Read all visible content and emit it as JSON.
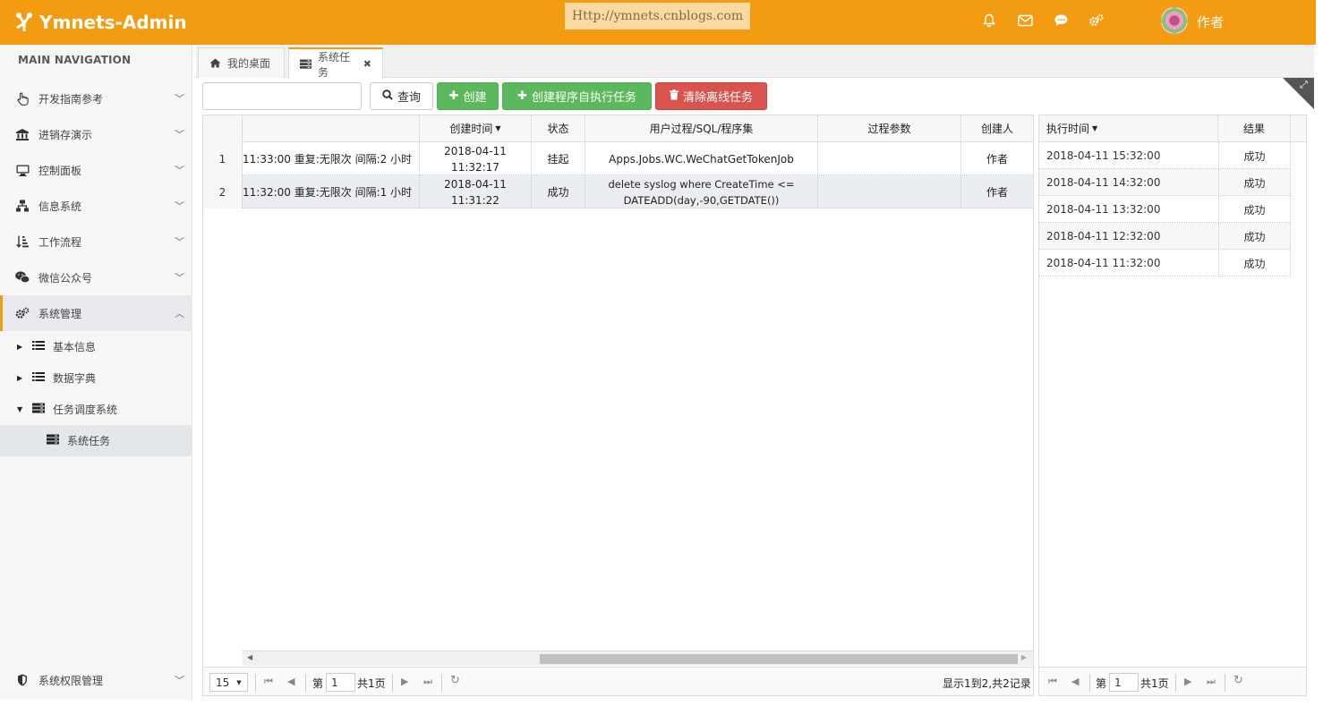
{
  "app": {
    "title": "Ymnets-Admin",
    "url_banner": "Http://ymnets.cnblogs.com",
    "user_name": "作者"
  },
  "colors": {
    "brand": "#f39c12",
    "success": "#5cb85c",
    "danger": "#d9534f"
  },
  "header_icons": [
    "bell-icon",
    "envelope-icon",
    "chat-icon",
    "gears-icon"
  ],
  "sidebar": {
    "heading": "MAIN NAVIGATION",
    "items": [
      {
        "label": "开发指南参考",
        "icon": "hand-pointer-icon"
      },
      {
        "label": "进销存演示",
        "icon": "bank-icon"
      },
      {
        "label": "控制面板",
        "icon": "desktop-icon"
      },
      {
        "label": "信息系统",
        "icon": "sitemap-icon"
      },
      {
        "label": "工作流程",
        "icon": "sort-amount-icon"
      },
      {
        "label": "微信公众号",
        "icon": "wechat-icon"
      },
      {
        "label": "系统管理",
        "icon": "gears-icon"
      }
    ],
    "sub_items": [
      {
        "label": "基本信息"
      },
      {
        "label": "数据字典"
      },
      {
        "label": "任务调度系统"
      },
      {
        "label": "系统任务"
      }
    ],
    "bottom_item": {
      "label": "系统权限管理"
    }
  },
  "tabs": [
    {
      "label": "我的桌面"
    },
    {
      "label": "系统任务"
    }
  ],
  "toolbar": {
    "search_placeholder": "",
    "query": "查询",
    "create": "创建",
    "create_program": "创建程序自执行任务",
    "clear_offline": "清除离线任务"
  },
  "jobs_grid": {
    "columns": [
      "",
      "创建时间",
      "状态",
      "用户过程/SQL/程序集",
      "过程参数",
      "创建人"
    ],
    "rows": [
      {
        "num": "1",
        "trigger": "11:33:00 重复:无限次 间隔:2 小时",
        "created_date": "2018-04-11",
        "created_time": "11:32:17",
        "status": "挂起",
        "proc": "Apps.Jobs.WC.WeChatGetTokenJob",
        "params": "",
        "creator": "作者"
      },
      {
        "num": "2",
        "trigger": "11:32:00 重复:无限次 间隔:1 小时",
        "created_date": "2018-04-11",
        "created_time": "11:31:22",
        "status": "成功",
        "proc": "delete syslog where CreateTime <= DATEADD(day,-90,GETDATE())",
        "params": "",
        "creator": "作者"
      }
    ],
    "pager": {
      "page_size": "15",
      "page_prefix": "第",
      "page": "1",
      "page_total": "共1页",
      "summary": "显示1到2,共2记录"
    }
  },
  "log_grid": {
    "columns": [
      "执行时间",
      "结果"
    ],
    "rows": [
      {
        "time": "2018-04-11 15:32:00",
        "result": "成功"
      },
      {
        "time": "2018-04-11 14:32:00",
        "result": "成功"
      },
      {
        "time": "2018-04-11 13:32:00",
        "result": "成功"
      },
      {
        "time": "2018-04-11 12:32:00",
        "result": "成功"
      },
      {
        "time": "2018-04-11 11:32:00",
        "result": "成功"
      }
    ],
    "pager": {
      "page_prefix": "第",
      "page": "1",
      "page_total": "共1页"
    }
  }
}
